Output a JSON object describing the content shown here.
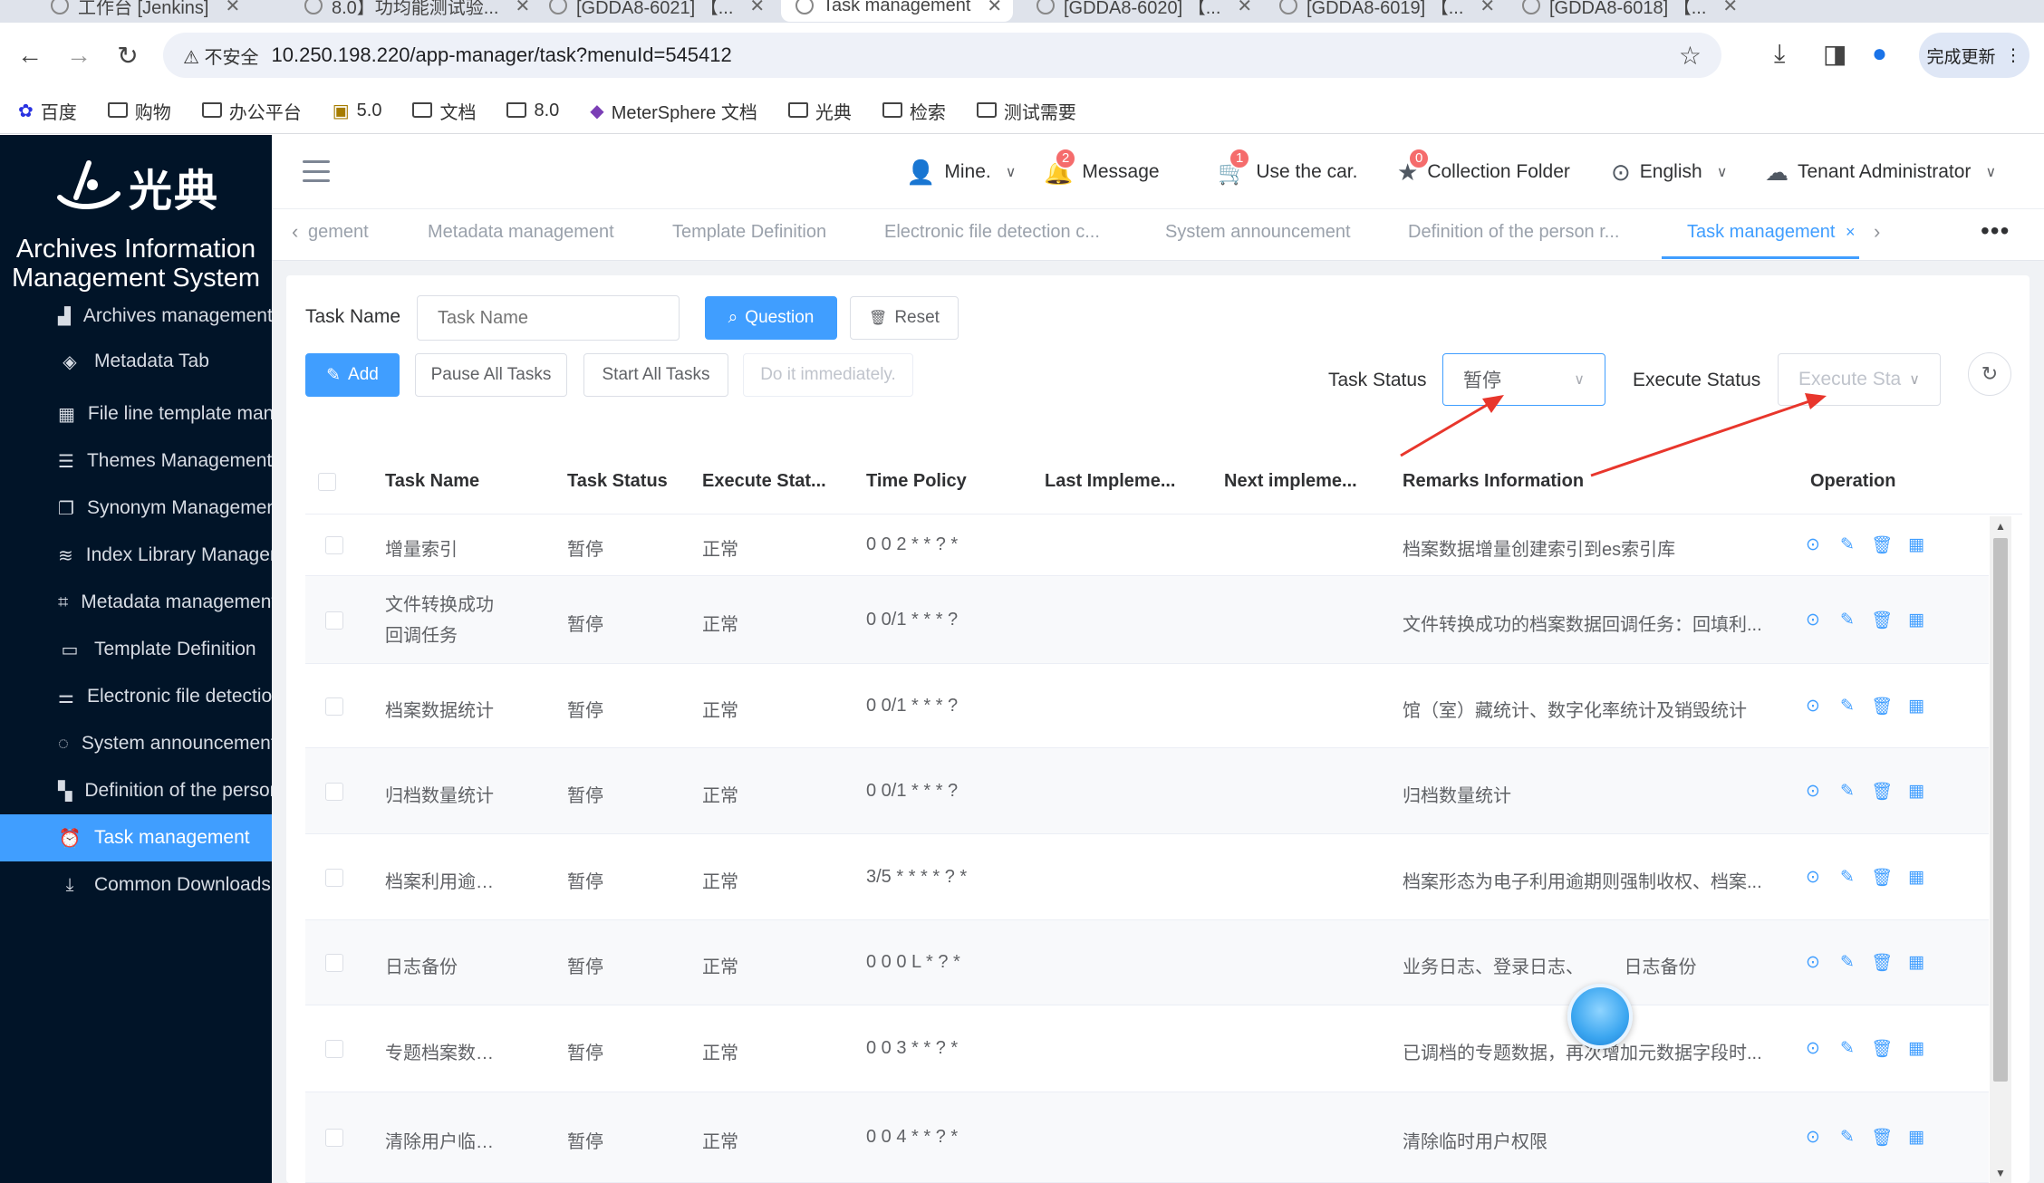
{
  "browser": {
    "tabs": [
      {
        "label": "工作台 [Jenkins]"
      },
      {
        "label": "8.0】功均能测试验..."
      },
      {
        "label": "[GDDA8-6021] 【..."
      },
      {
        "label": "Task management"
      },
      {
        "label": "[GDDA8-6020] 【..."
      },
      {
        "label": "[GDDA8-6019] 【..."
      },
      {
        "label": "[GDDA8-6018] 【..."
      }
    ],
    "security_label": "不安全",
    "url": "10.250.198.220/app-manager/task?menuId=545412",
    "update_label": "完成更新",
    "bookmarks": [
      {
        "label": "百度",
        "icon": "baidu-icon"
      },
      {
        "label": "购物",
        "icon": "folder-icon"
      },
      {
        "label": "办公平台",
        "icon": "folder-icon"
      },
      {
        "label": "5.0",
        "icon": "image-icon"
      },
      {
        "label": "文档",
        "icon": "folder-icon"
      },
      {
        "label": "8.0",
        "icon": "folder-icon"
      },
      {
        "label": "MeterSphere 文档",
        "icon": "metersphere-icon"
      },
      {
        "label": "光典",
        "icon": "folder-icon"
      },
      {
        "label": "检索",
        "icon": "folder-icon"
      },
      {
        "label": "测试需要",
        "icon": "folder-icon"
      }
    ]
  },
  "brand": {
    "logo_text": "光典",
    "title_line1": "Archives Information",
    "title_line2": "Management System"
  },
  "sidebar": {
    "items": [
      {
        "label": "Archives management",
        "icon": "chart-icon"
      },
      {
        "label": "Metadata Tab",
        "icon": "tag-icon"
      },
      {
        "label": "File line template management",
        "icon": "table-icon"
      },
      {
        "label": "Themes Management",
        "icon": "list-icon"
      },
      {
        "label": "Synonym Management",
        "icon": "document-icon"
      },
      {
        "label": "Index Library Management",
        "icon": "layers-icon"
      },
      {
        "label": "Metadata management",
        "icon": "crop-icon"
      },
      {
        "label": "Template Definition",
        "icon": "template-icon"
      },
      {
        "label": "Electronic file detection",
        "icon": "sliders-icon"
      },
      {
        "label": "System announcement",
        "icon": "chat-icon"
      },
      {
        "label": "Definition of the person",
        "icon": "grid-icon"
      },
      {
        "label": "Task management",
        "icon": "alarm-icon",
        "active": true
      },
      {
        "label": "Common Downloads",
        "icon": "download-icon"
      }
    ]
  },
  "header": {
    "mine": "Mine.",
    "message": "Message",
    "message_count": "2",
    "cart": "Use the car.",
    "cart_count": "1",
    "collection": "Collection Folder",
    "collection_count": "0",
    "language": "English",
    "tenant": "Tenant Administrator"
  },
  "page_tabs": {
    "items": [
      "gement",
      "Metadata management",
      "Template Definition",
      "Electronic file detection c...",
      "System announcement",
      "Definition of the person r...",
      "Task management"
    ],
    "close": "×",
    "more": "•••"
  },
  "filters": {
    "task_name_label": "Task Name",
    "task_name_placeholder": "Task Name",
    "task_name_value": "",
    "search_label": "Question",
    "reset_label": "Reset",
    "task_status_label": "Task Status",
    "task_status_value": "暂停",
    "execute_status_label": "Execute Status",
    "execute_status_placeholder": "Execute Sta"
  },
  "actions": {
    "add": "Add",
    "pause_all": "Pause All Tasks",
    "start_all": "Start All Tasks",
    "do_now": "Do it immediately."
  },
  "table": {
    "columns": [
      "Task Name",
      "Task Status",
      "Execute Stat...",
      "Time Policy",
      "Last Impleme...",
      "Next impleme...",
      "Remarks Information",
      "Operation"
    ],
    "rows": [
      {
        "name": "增量索引",
        "status": "暂停",
        "exec": "正常",
        "policy": "0 0 2 * * ? *",
        "last": "",
        "next": "",
        "remarks": "档案数据增量创建索引到es索引库"
      },
      {
        "name": "文件转换成功回调任务",
        "status": "暂停",
        "exec": "正常",
        "policy": "0 0/1 * * * ?",
        "last": "",
        "next": "",
        "remarks": "文件转换成功的档案数据回调任务：回填利..."
      },
      {
        "name": "档案数据统计",
        "status": "暂停",
        "exec": "正常",
        "policy": "0 0/1 * * * ?",
        "last": "",
        "next": "",
        "remarks": "馆（室）藏统计、数字化率统计及销毁统计"
      },
      {
        "name": "归档数量统计",
        "status": "暂停",
        "exec": "正常",
        "policy": "0 0/1 * * * ?",
        "last": "",
        "next": "",
        "remarks": "归档数量统计"
      },
      {
        "name": "档案利用逾期处理",
        "status": "暂停",
        "exec": "正常",
        "policy": "3/5 * * * * ? *",
        "last": "",
        "next": "",
        "remarks": "档案形态为电子利用逾期则强制收权、档案..."
      },
      {
        "name": "日志备份",
        "status": "暂停",
        "exec": "正常",
        "policy": "0 0 0 L * ? *",
        "last": "",
        "next": "",
        "remarks": "业务日志、登录日志、        日志备份"
      },
      {
        "name": "专题档案数据补偿",
        "status": "暂停",
        "exec": "正常",
        "policy": "0 0 3 * * ? *",
        "last": "",
        "next": "",
        "remarks": "已调档的专题数据，再次增加元数据字段时..."
      },
      {
        "name": "清除用户临时权限",
        "status": "暂停",
        "exec": "正常",
        "policy": "0 0 4 * * ? *",
        "last": "",
        "next": "",
        "remarks": "清除临时用户权限"
      }
    ]
  },
  "colors": {
    "primary": "#409eff",
    "sidebar_bg": "#011428",
    "annotation_arrow": "#e8362c",
    "badge": "#f56c6c"
  }
}
